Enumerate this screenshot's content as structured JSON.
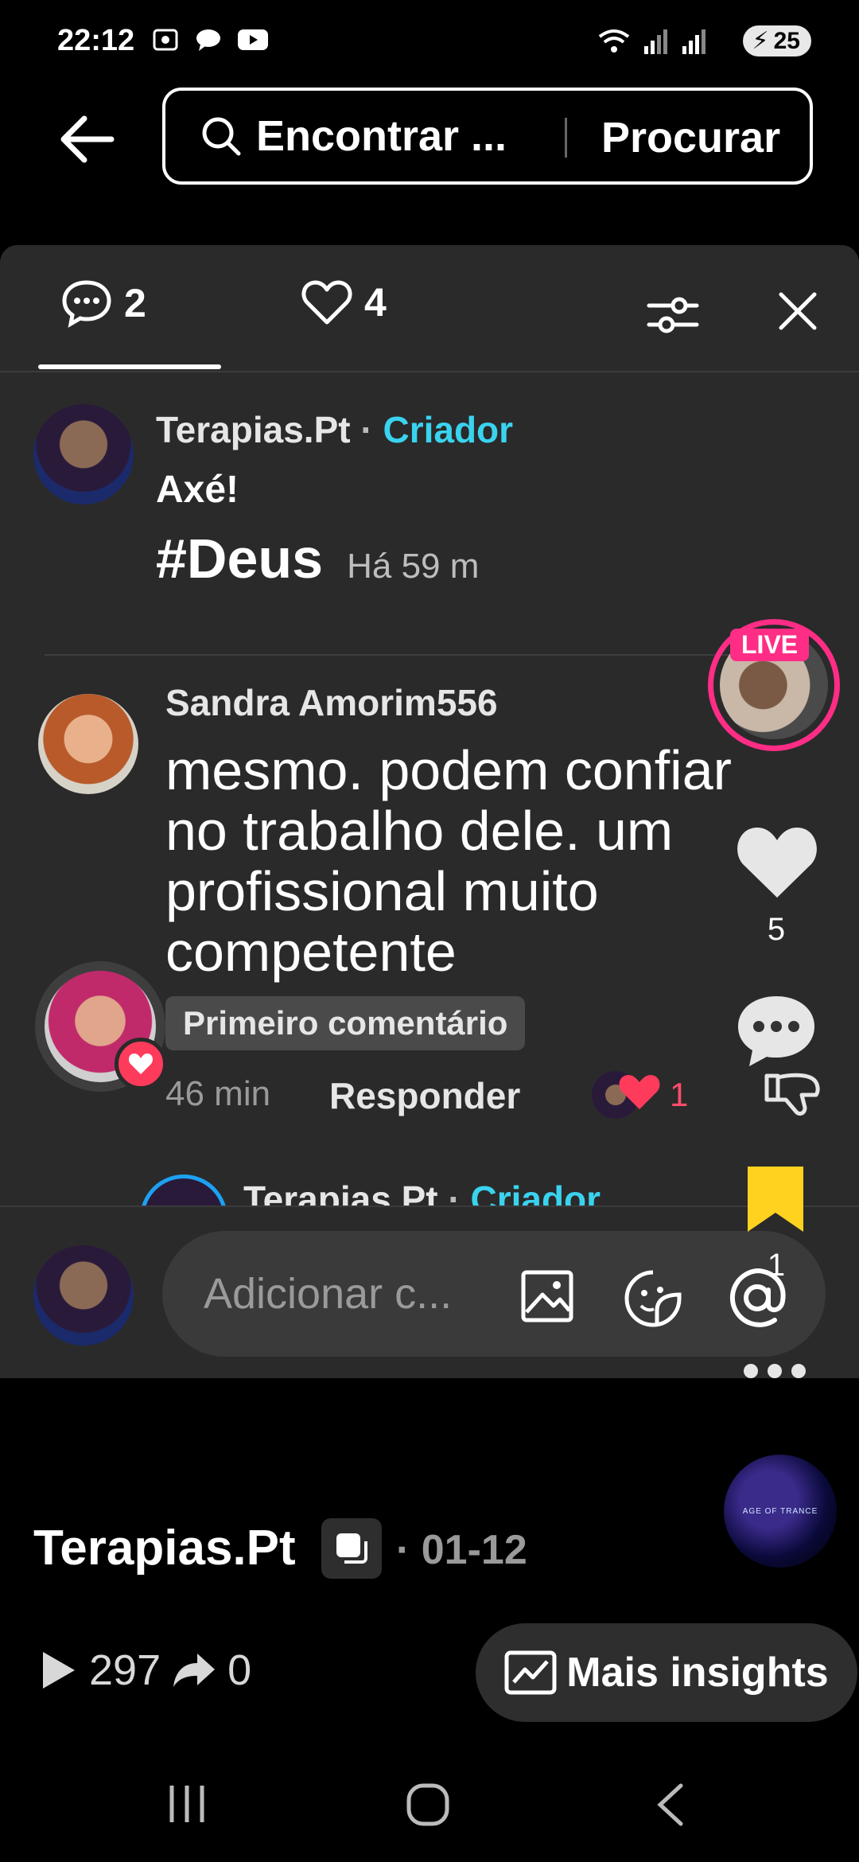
{
  "status_bar": {
    "time": "22:12",
    "battery": "25"
  },
  "top_bar": {
    "search_text": "Encontrar ...",
    "search_button": "Procurar"
  },
  "tabs": {
    "comments_count": "2",
    "likes_count": "4"
  },
  "comments": [
    {
      "author": "Terapias.Pt",
      "separator": "·",
      "role": "Criador",
      "text": "Axé!",
      "hashtag": "#Deus",
      "time": "Há 59 m"
    },
    {
      "author": "Sandra Amorim556",
      "text": "mesmo. podem confiar no trabalho dele. um profissional muito competente",
      "badge": "Primeiro comentário",
      "time": "46 min",
      "reply_label": "Responder",
      "reaction_count": "1"
    }
  ],
  "reply_preview": {
    "author": "Terapias.Pt",
    "separator": "·",
    "role": "Criador"
  },
  "input": {
    "placeholder": "Adicionar c..."
  },
  "right_rail": {
    "live_label": "LIVE",
    "like_count": "5",
    "save_count": "1",
    "music_label": "AGE OF TRANCE"
  },
  "post": {
    "author": "Terapias.Pt",
    "date": "· 01-12",
    "plays": "297",
    "shares": "0",
    "insights_label": "Mais insights"
  },
  "colors": {
    "accent_creator": "#3ad3ef",
    "live": "#ff2d86",
    "save": "#ffd21f",
    "heart": "#ff3b5c"
  }
}
